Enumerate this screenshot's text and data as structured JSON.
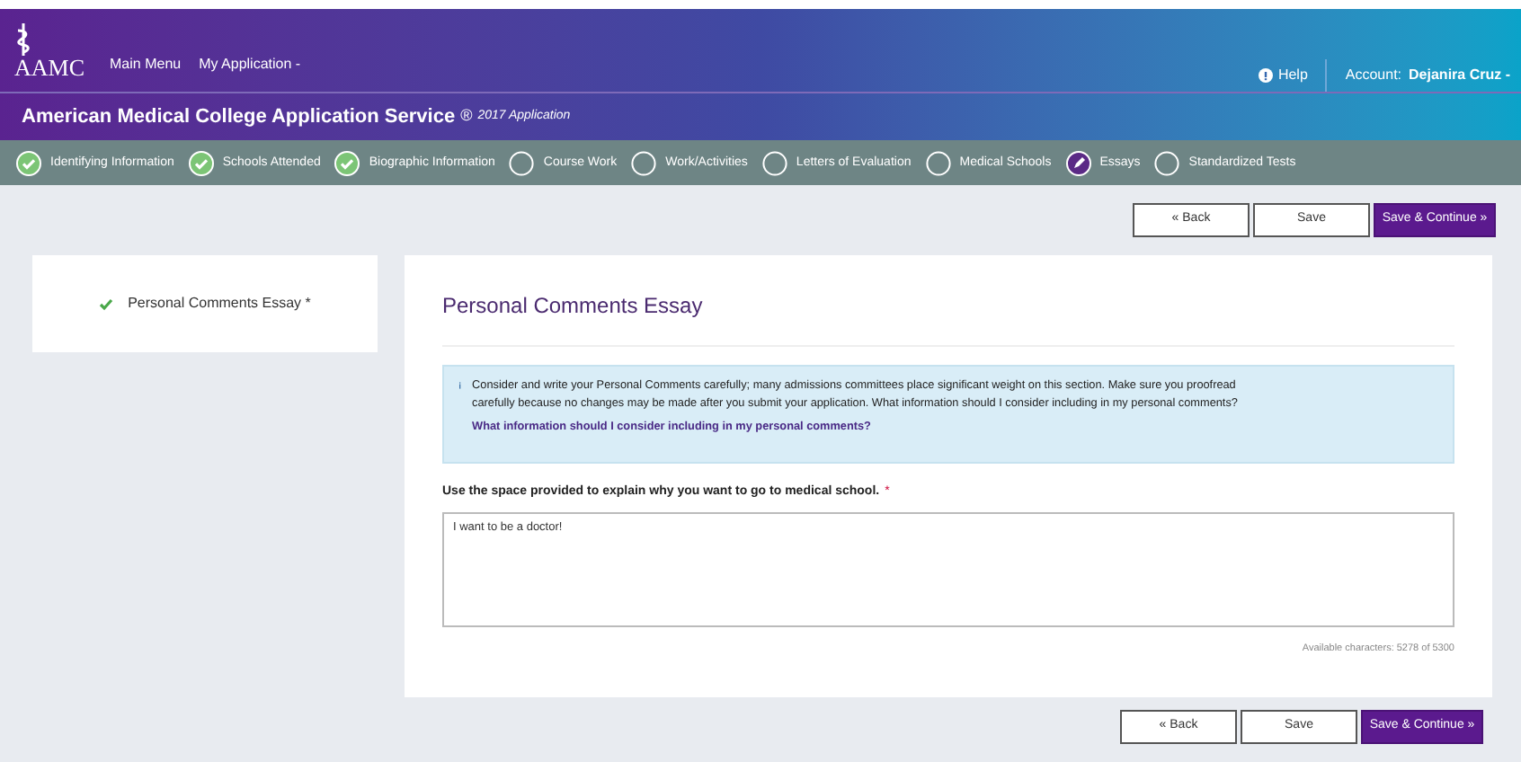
{
  "header": {
    "logo": "AAMC",
    "nav": [
      "Main Menu",
      "My Application -"
    ],
    "help": "Help",
    "account_label": "Account:",
    "account_name": "Dejanira Cruz -"
  },
  "title": {
    "main": "American Medical College Application Service",
    "mark": "®",
    "sub": "2017 Application"
  },
  "steps": [
    {
      "label": "Identifying Information",
      "kind": "complete"
    },
    {
      "label": "Schools Attended",
      "kind": "complete"
    },
    {
      "label": "Biographic Information",
      "kind": "complete"
    },
    {
      "label": "Course Work",
      "kind": "incomplete"
    },
    {
      "label": "Work/Activities",
      "kind": "incomplete"
    },
    {
      "label": "Letters of Evaluation",
      "kind": "incomplete"
    },
    {
      "label": "Medical Schools",
      "kind": "incomplete"
    },
    {
      "label": "Essays",
      "kind": "current"
    },
    {
      "label": "Standardized Tests",
      "kind": "incomplete"
    }
  ],
  "top_buttons": [
    {
      "label": "« Back",
      "primary": false
    },
    {
      "label": "Save",
      "primary": false
    },
    {
      "label": "Save & Continue »",
      "primary": true
    }
  ],
  "sidebar": {
    "items": [
      {
        "label": "Personal Comments Essay *",
        "complete": true
      }
    ]
  },
  "content": {
    "heading": "Personal Comments Essay",
    "info": "Consider and write your Personal Comments carefully; many admissions committees place significant weight on this section. Make sure you proofread carefully because no changes may be made after you submit your application. What information should I consider including in my personal comments?",
    "info_link": "What information should I consider including in my personal comments?",
    "question": "Use the space provided to explain why you want to go to medical school.",
    "required": "*",
    "answer": "I want to be a doctor!",
    "counter": "Available characters: 5278 of 5300"
  },
  "bottom_buttons": [
    {
      "label": "« Back",
      "primary": false
    },
    {
      "label": "Save",
      "primary": false
    },
    {
      "label": "Save & Continue »",
      "primary": true
    }
  ]
}
